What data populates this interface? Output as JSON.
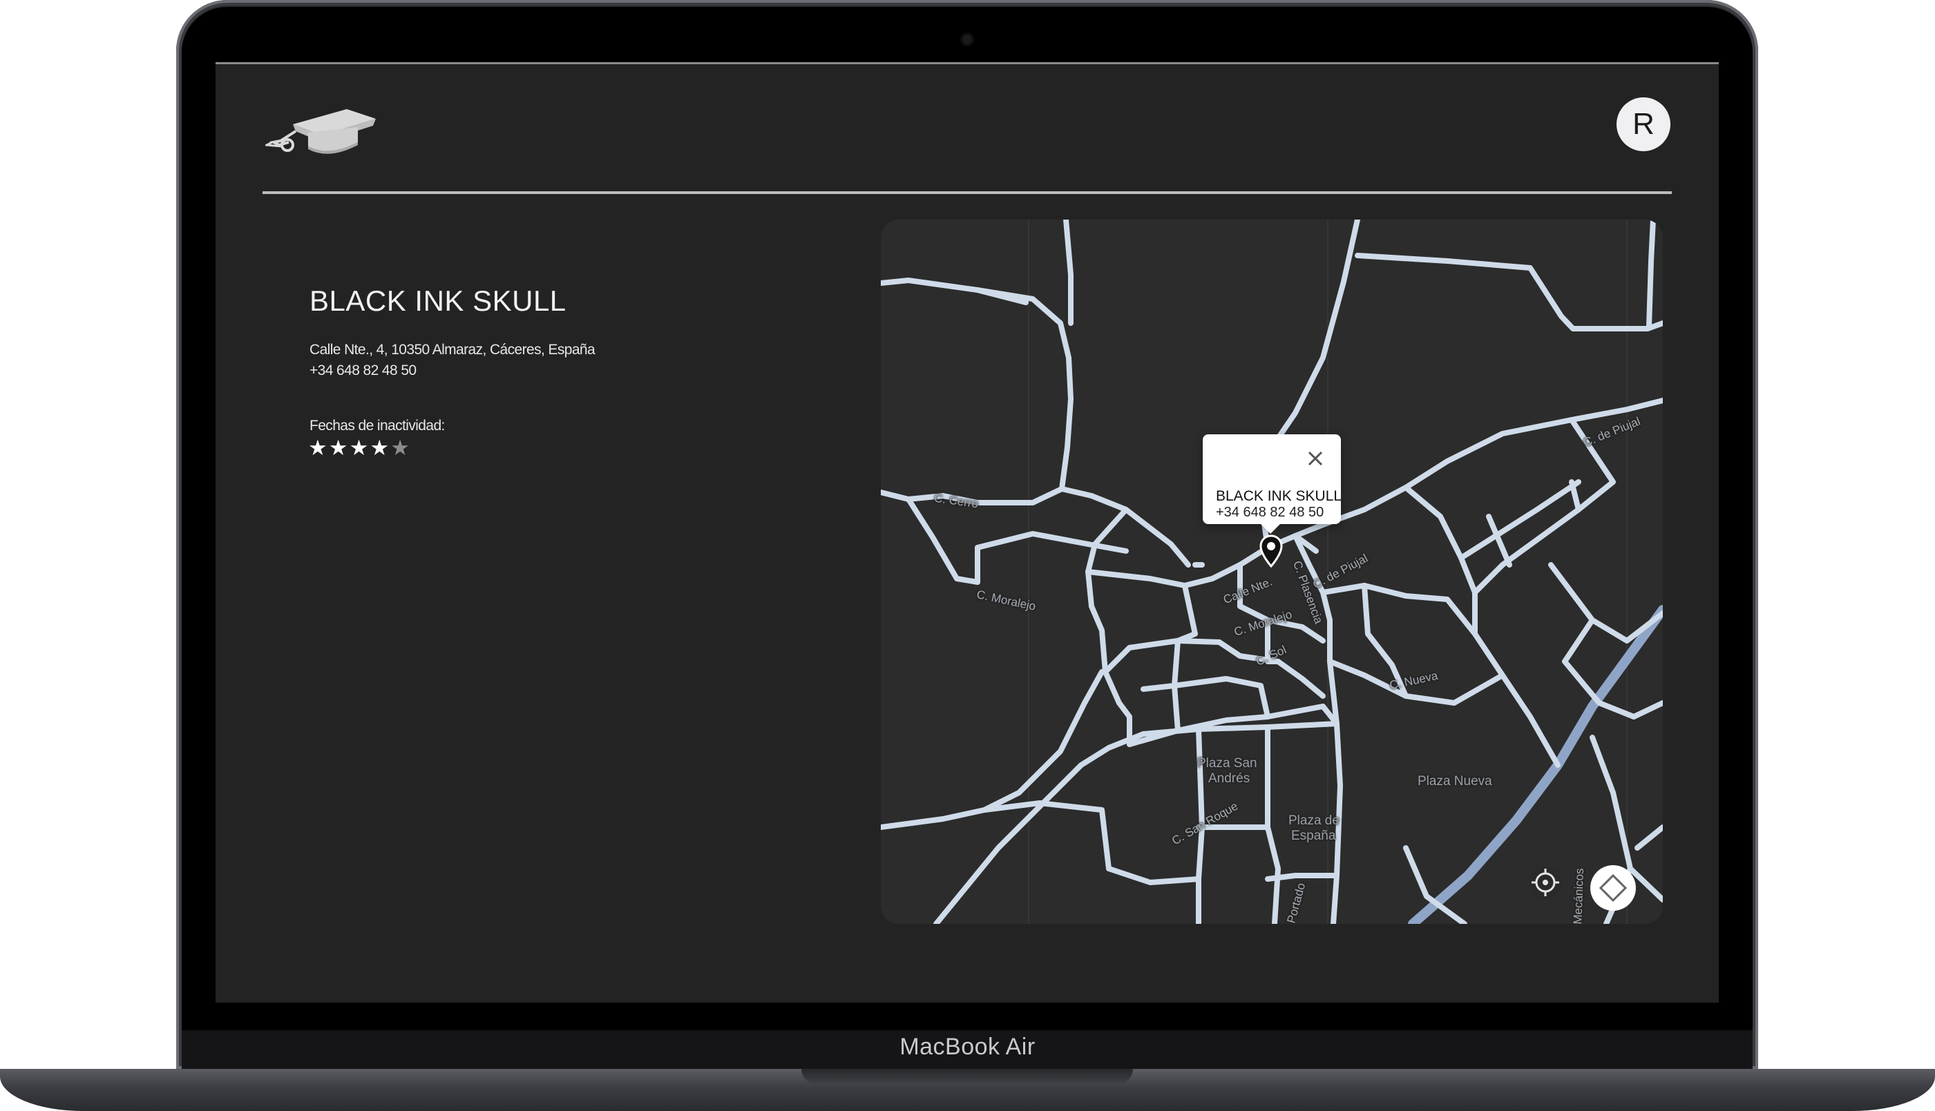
{
  "device": {
    "model_label": "MacBook Air"
  },
  "header": {
    "logo_icon": "graduation-cap-icon",
    "avatar_initial": "R"
  },
  "business": {
    "name": "BLACK INK SKULL",
    "address": "Calle Nte., 4, 10350 Almaraz, Cáceres, España",
    "phone": "+34 648 82 48 50",
    "inactivity_label": "Fechas de inactividad:",
    "rating": 4,
    "rating_max": 5
  },
  "map": {
    "popup": {
      "title": "BLACK INK SKULL",
      "phone": "+34 648 82 48 50",
      "close_icon": "close-icon"
    },
    "pin_icon": "map-pin-icon",
    "labels": {
      "c_cerro": "C. Cerro",
      "c_moralejo_west": "C. Moralejo",
      "calle_nte": "Calle Nte.",
      "c_moralejo_center": "C. Moralejo",
      "c_plasencia": "C. Plasencia",
      "c_piujal_center": "C. de Piujal",
      "c_piujal_east": "C. de Piujal",
      "c_sol": "C. Sol",
      "c_nueva": "C. Nueva",
      "plaza_san_andres_1": "Plaza San",
      "plaza_san_andres_2": "Andrés",
      "plaza_nueva": "Plaza Nueva",
      "c_san_roque": "C. San Roque",
      "plaza_espana_1": "Plaza de",
      "plaza_espana_2": "España",
      "c_portado": "Portado",
      "c_mecanicos": "Mecánicos"
    },
    "controls": {
      "locate_icon": "crosshair-icon",
      "fullscreen_icon": "fullscreen-icon"
    },
    "colors": {
      "background": "#2c2c2c",
      "road": "#cfdbe9",
      "highway": "#8fa5c7"
    }
  }
}
